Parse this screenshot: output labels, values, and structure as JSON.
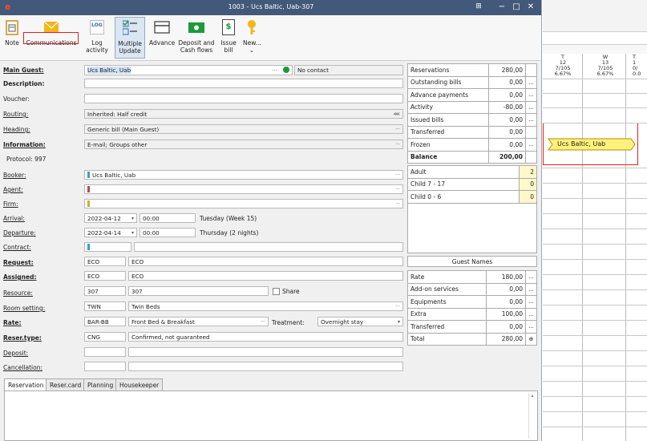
{
  "window": {
    "logo": "e",
    "title": "1003 - Ucs Baltic, Uab-307"
  },
  "ribbon": {
    "buttons": [
      {
        "id": "note",
        "label": "Note"
      },
      {
        "id": "communications",
        "label": "Communications"
      },
      {
        "id": "log-activity",
        "label": "Log activity",
        "icon_text": "LOG"
      },
      {
        "id": "multiple-update",
        "label": "Multiple Update"
      },
      {
        "id": "advance",
        "label": "Advance"
      },
      {
        "id": "deposit",
        "label": "Deposit and Cash flows"
      },
      {
        "id": "issue-bill",
        "label": "Issue bill",
        "icon_text": "$"
      },
      {
        "id": "new",
        "label": "New...",
        "sub": "⌄"
      }
    ]
  },
  "form": {
    "main_guest": {
      "label": "Main Guest:",
      "value": "Ucs Baltic, Uab",
      "contact": "No contact"
    },
    "description": {
      "label": "Description:",
      "value": ""
    },
    "voucher": {
      "label": "Voucher:",
      "value": ""
    },
    "routing": {
      "label": "Routing:",
      "value": "Inherited: Half credit"
    },
    "heading": {
      "label": "Heading:",
      "value": "Generic bill (Main Guest)"
    },
    "information": {
      "label": "Information:",
      "value": "E-mail; Groups other"
    },
    "protocol": "Protocol: 997",
    "booker": {
      "label": "Booker:",
      "value": "Ucs Baltic, Uab"
    },
    "agent": {
      "label": "Agent:",
      "value": ""
    },
    "firm": {
      "label": "Firm:",
      "value": ""
    },
    "arrival": {
      "label": "Arrival:",
      "date": "2022-04-12",
      "time": "00:00",
      "info": "Tuesday (Week 15)"
    },
    "departure": {
      "label": "Departure:",
      "date": "2022-04-14",
      "time": "00:00",
      "info": "Thursday (2 nights)"
    },
    "contract": {
      "label": "Contract:"
    },
    "request": {
      "label": "Request:",
      "code": "ECO",
      "value": "ECO"
    },
    "assigned": {
      "label": "Assigned:",
      "code": "ECO",
      "value": "ECO"
    },
    "resource": {
      "label": "Resource:",
      "code": "307",
      "value": "307",
      "share": "Share"
    },
    "room_setting": {
      "label": "Room setting:",
      "code": "TWN",
      "value": "Twin Beds"
    },
    "rate": {
      "label": "Rate:",
      "code": "BAR-BB",
      "value": "Front Bed & Breakfast",
      "treatment_label": "Treatment:",
      "treatment": "Overnight stay"
    },
    "reser_type": {
      "label": "Reser.type:",
      "code": "CNG",
      "value": "Confirmed, not guaranteed"
    },
    "deposit": {
      "label": "Deposit:"
    },
    "cancellation": {
      "label": "Cancellation:"
    }
  },
  "summary": [
    {
      "label": "Reservations",
      "value": "280,00",
      "dots": false
    },
    {
      "label": "Outstanding bills",
      "value": "0,00",
      "dots": true
    },
    {
      "label": "Advance payments",
      "value": "0,00",
      "dots": true
    },
    {
      "label": "Activity",
      "value": "-80,00",
      "dots": true
    },
    {
      "label": "Issued bills",
      "value": "0,00",
      "dots": true
    },
    {
      "label": "Transferred",
      "value": "0,00",
      "dots": false
    },
    {
      "label": "Frozen",
      "value": "0,00",
      "dots": true
    },
    {
      "label": "Balance",
      "value": "200,00",
      "dots": false
    }
  ],
  "pax": [
    {
      "label": "Adult",
      "value": "2"
    },
    {
      "label": "Child 7 - 17",
      "value": "0"
    },
    {
      "label": "Child 0 - 6",
      "value": "0"
    }
  ],
  "guest_names": "Guest Names",
  "rates": [
    {
      "label": "Rate",
      "value": "180,00"
    },
    {
      "label": "Add-on services",
      "value": "0,00"
    },
    {
      "label": "Equipments",
      "value": "0,00"
    },
    {
      "label": "Extra",
      "value": "100,00"
    },
    {
      "label": "Transferred",
      "value": "0,00"
    },
    {
      "label": "Total",
      "value": "280,00"
    }
  ],
  "tabs": [
    "Reservation",
    "Reser.card",
    "Planning",
    "Housekeeper"
  ],
  "calendar": {
    "days": [
      {
        "dow": "T",
        "num": "12",
        "occ": "7/105",
        "pct": "6.67%"
      },
      {
        "dow": "W",
        "num": "13",
        "occ": "7/105",
        "pct": "6.67%"
      },
      {
        "dow": "T",
        "num": "1",
        "occ": "0/",
        "pct": "0.0"
      }
    ],
    "booking": "Ucs Baltic, Uab"
  },
  "colors": {
    "titlebar": "#43597a",
    "highlight": "#e02020",
    "booking": "#fff27a",
    "booking_border": "#b68a00"
  }
}
